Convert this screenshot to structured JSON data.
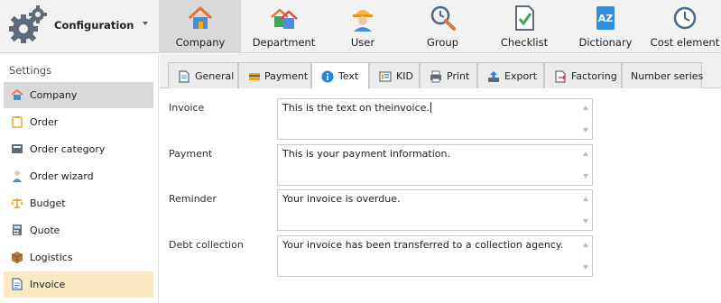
{
  "app": {
    "title": "Configuration"
  },
  "nav": [
    {
      "label": "Company",
      "icon": "house-icon"
    },
    {
      "label": "Department",
      "icon": "houses-icon"
    },
    {
      "label": "User",
      "icon": "worker-icon"
    },
    {
      "label": "Group",
      "icon": "wrench-clock-icon"
    },
    {
      "label": "Checklist",
      "icon": "checklist-icon"
    },
    {
      "label": "Dictionary",
      "icon": "dictionary-icon"
    },
    {
      "label": "Cost element",
      "icon": "clock-icon"
    }
  ],
  "sidebar": {
    "heading": "Settings",
    "items": [
      {
        "label": "Company",
        "icon": "house-icon"
      },
      {
        "label": "Order",
        "icon": "clipboard-icon"
      },
      {
        "label": "Order category",
        "icon": "category-icon"
      },
      {
        "label": "Order wizard",
        "icon": "wizard-icon"
      },
      {
        "label": "Budget",
        "icon": "scales-icon"
      },
      {
        "label": "Quote",
        "icon": "calculator-icon"
      },
      {
        "label": "Logistics",
        "icon": "box-icon"
      },
      {
        "label": "Invoice",
        "icon": "invoice-icon"
      }
    ]
  },
  "tabs": [
    {
      "label": "General",
      "icon": "document-icon"
    },
    {
      "label": "Payment",
      "icon": "payment-icon"
    },
    {
      "label": "Text",
      "icon": "info-icon"
    },
    {
      "label": "KID",
      "icon": "kid-icon"
    },
    {
      "label": "Print",
      "icon": "printer-icon"
    },
    {
      "label": "Export",
      "icon": "export-icon"
    },
    {
      "label": "Factoring",
      "icon": "factoring-icon"
    },
    {
      "label": "Number series",
      "icon": ""
    }
  ],
  "fields": [
    {
      "label": "Invoice",
      "value": "This is the text on theinvoice."
    },
    {
      "label": "Payment",
      "value": "This is your payment information."
    },
    {
      "label": "Reminder",
      "value": "Your invoice is overdue."
    },
    {
      "label": "Debt collection",
      "value": "Your invoice has been transferred to a collection agency."
    }
  ],
  "colors": {
    "accent_selected": "#d9d9d9",
    "active_item": "#fbe9c3",
    "info_blue": "#1e88e5"
  }
}
